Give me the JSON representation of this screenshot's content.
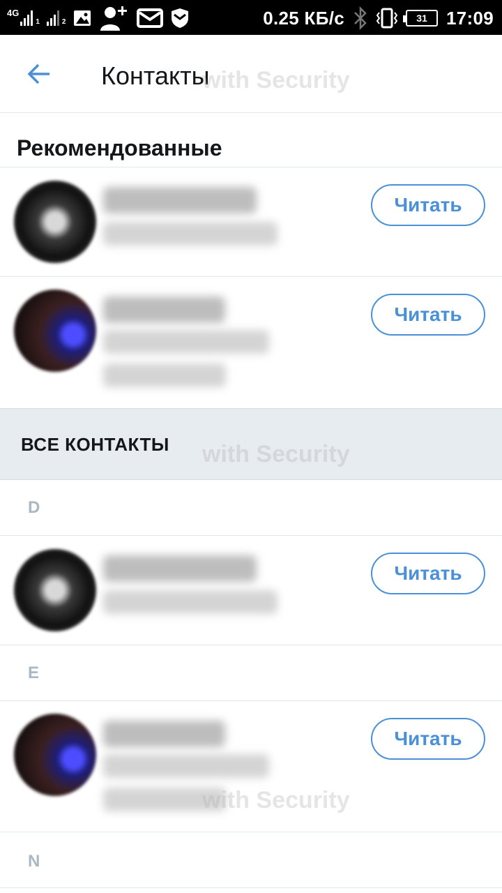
{
  "status_bar": {
    "network": "4G",
    "sim1": "1",
    "sim2": "2",
    "speed": "0.25 КБ/с",
    "battery": "31",
    "time": "17:09",
    "icons": [
      "signal-icon",
      "signal-icon",
      "image-icon",
      "add-contact-icon",
      "message-icon",
      "shield-icon",
      "bluetooth-icon",
      "vibrate-icon",
      "battery-icon"
    ]
  },
  "toolbar": {
    "back_icon": "back-arrow-icon",
    "title": "Контакты"
  },
  "recommended": {
    "title": "Рекомендованные",
    "items": [
      {
        "follow_label": "Читать",
        "avatar": "avatar-dark"
      },
      {
        "follow_label": "Читать",
        "avatar": "avatar-blue"
      }
    ]
  },
  "all_contacts": {
    "title": "ВСЕ КОНТАКТЫ",
    "groups": [
      {
        "letter": "D",
        "items": [
          {
            "follow_label": "Читать",
            "avatar": "avatar-dark"
          }
        ]
      },
      {
        "letter": "E",
        "items": [
          {
            "follow_label": "Читать",
            "avatar": "avatar-blue"
          }
        ]
      },
      {
        "letter": "N",
        "items": []
      }
    ]
  },
  "watermark": "with Security",
  "colors": {
    "accent": "#4a90d9",
    "section_bg": "#e6ecf0",
    "divider": "#e1e8ed",
    "letter": "#aab8c2"
  }
}
